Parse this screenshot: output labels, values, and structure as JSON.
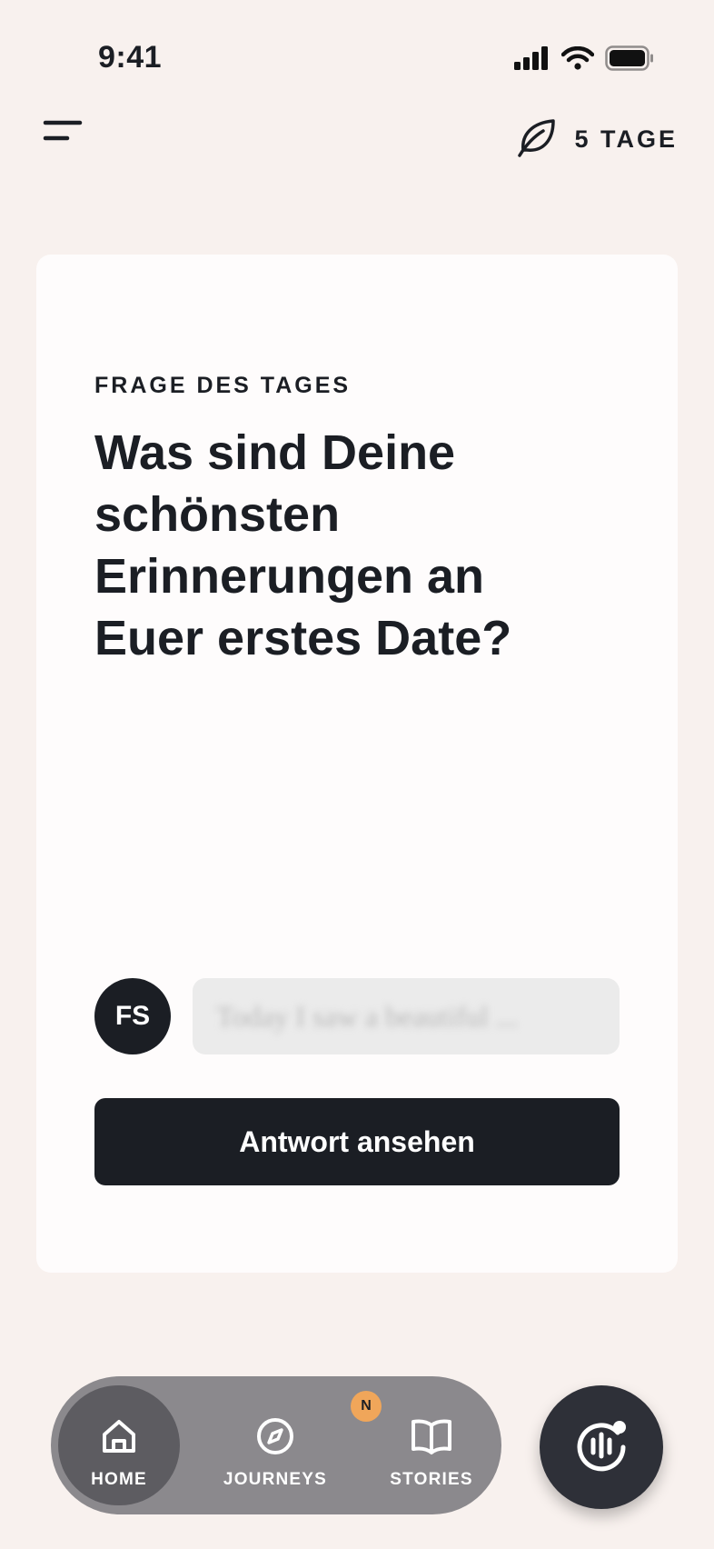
{
  "status_bar": {
    "time": "9:41"
  },
  "header": {
    "streak_label": "5 TAGE"
  },
  "card": {
    "eyebrow": "FRAGE DES TAGES",
    "question": "Was sind Deine schönsten Erinnerungen an Euer erstes Date?",
    "avatar_initials": "FS",
    "answer_preview": "Today I saw a beautiful ...",
    "primary_button": "Antwort ansehen"
  },
  "nav": {
    "tabs": [
      {
        "label": "HOME"
      },
      {
        "label": "JOURNEYS",
        "badge": "N"
      },
      {
        "label": "STORIES"
      }
    ]
  },
  "colors": {
    "background": "#f8f1ee",
    "card": "#fefcfc",
    "dark": "#1b1e24",
    "badge": "#f0a65a",
    "tabbar": "#8b898d",
    "tab_active": "#5d5c61",
    "fab": "#2e3038"
  },
  "icons": [
    "signal-icon",
    "wifi-icon",
    "battery-icon",
    "menu-icon",
    "leaf-icon",
    "home-icon",
    "compass-icon",
    "book-icon",
    "voice-icon"
  ]
}
